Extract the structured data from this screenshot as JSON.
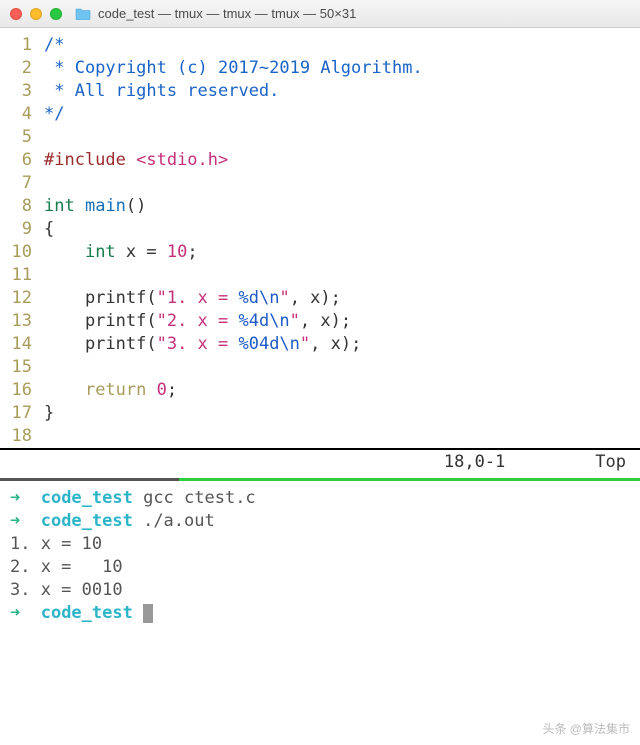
{
  "window": {
    "title": "code_test — tmux — tmux — tmux — 50×31"
  },
  "code": {
    "lines": [
      {
        "n": "1",
        "t": "/*",
        "cls": "cmt"
      },
      {
        "n": "2",
        "t": " * Copyright (c) 2017~2019 Algorithm.",
        "cls": "cmt"
      },
      {
        "n": "3",
        "t": " * All rights reserved.",
        "cls": "cmt"
      },
      {
        "n": "4",
        "t": "*/",
        "cls": "cmt"
      },
      {
        "n": "5",
        "t": "",
        "cls": ""
      },
      {
        "n": "6",
        "segments": [
          {
            "t": "#include ",
            "cls": "inc"
          },
          {
            "t": "<stdio.h>",
            "cls": "inc-path"
          }
        ]
      },
      {
        "n": "7",
        "t": "",
        "cls": ""
      },
      {
        "n": "8",
        "segments": [
          {
            "t": "int",
            "cls": "type"
          },
          {
            "t": " ",
            "cls": ""
          },
          {
            "t": "main",
            "cls": "fn"
          },
          {
            "t": "()",
            "cls": ""
          }
        ]
      },
      {
        "n": "9",
        "t": "{",
        "cls": ""
      },
      {
        "n": "10",
        "segments": [
          {
            "t": "    ",
            "cls": ""
          },
          {
            "t": "int",
            "cls": "type"
          },
          {
            "t": " x = ",
            "cls": ""
          },
          {
            "t": "10",
            "cls": "num"
          },
          {
            "t": ";",
            "cls": ""
          }
        ]
      },
      {
        "n": "11",
        "t": "",
        "cls": ""
      },
      {
        "n": "12",
        "segments": [
          {
            "t": "    printf(",
            "cls": ""
          },
          {
            "t": "\"1. x = ",
            "cls": "str"
          },
          {
            "t": "%d\\n",
            "cls": "fmt"
          },
          {
            "t": "\"",
            "cls": "str"
          },
          {
            "t": ", x);",
            "cls": ""
          }
        ]
      },
      {
        "n": "13",
        "segments": [
          {
            "t": "    printf(",
            "cls": ""
          },
          {
            "t": "\"2. x = ",
            "cls": "str"
          },
          {
            "t": "%4d\\n",
            "cls": "fmt"
          },
          {
            "t": "\"",
            "cls": "str"
          },
          {
            "t": ", x);",
            "cls": ""
          }
        ]
      },
      {
        "n": "14",
        "segments": [
          {
            "t": "    printf(",
            "cls": ""
          },
          {
            "t": "\"3. x = ",
            "cls": "str"
          },
          {
            "t": "%04d\\n",
            "cls": "fmt"
          },
          {
            "t": "\"",
            "cls": "str"
          },
          {
            "t": ", x);",
            "cls": ""
          }
        ]
      },
      {
        "n": "15",
        "t": "",
        "cls": ""
      },
      {
        "n": "16",
        "segments": [
          {
            "t": "    ",
            "cls": ""
          },
          {
            "t": "return",
            "cls": "kw"
          },
          {
            "t": " ",
            "cls": ""
          },
          {
            "t": "0",
            "cls": "num"
          },
          {
            "t": ";",
            "cls": ""
          }
        ]
      },
      {
        "n": "17",
        "t": "}",
        "cls": ""
      },
      {
        "n": "18",
        "t": "",
        "cls": ""
      }
    ]
  },
  "status": {
    "pos": "18,0-1",
    "scroll": "Top"
  },
  "terminal": {
    "lines": [
      {
        "segments": [
          {
            "t": "➜  ",
            "cls": "arrow"
          },
          {
            "t": "code_test",
            "cls": "cwd"
          },
          {
            "t": " gcc ctest.c",
            "cls": "out"
          }
        ]
      },
      {
        "segments": [
          {
            "t": "➜  ",
            "cls": "arrow"
          },
          {
            "t": "code_test",
            "cls": "cwd"
          },
          {
            "t": " ./a.out",
            "cls": "out"
          }
        ]
      },
      {
        "segments": [
          {
            "t": "1. x = 10",
            "cls": "out"
          }
        ]
      },
      {
        "segments": [
          {
            "t": "2. x =   10",
            "cls": "out"
          }
        ]
      },
      {
        "segments": [
          {
            "t": "3. x = 0010",
            "cls": "out"
          }
        ]
      },
      {
        "segments": [
          {
            "t": "➜  ",
            "cls": "arrow"
          },
          {
            "t": "code_test",
            "cls": "cwd"
          },
          {
            "t": " ",
            "cls": "out"
          }
        ],
        "cursor": true
      }
    ]
  },
  "watermark": "头条 @算法集市"
}
